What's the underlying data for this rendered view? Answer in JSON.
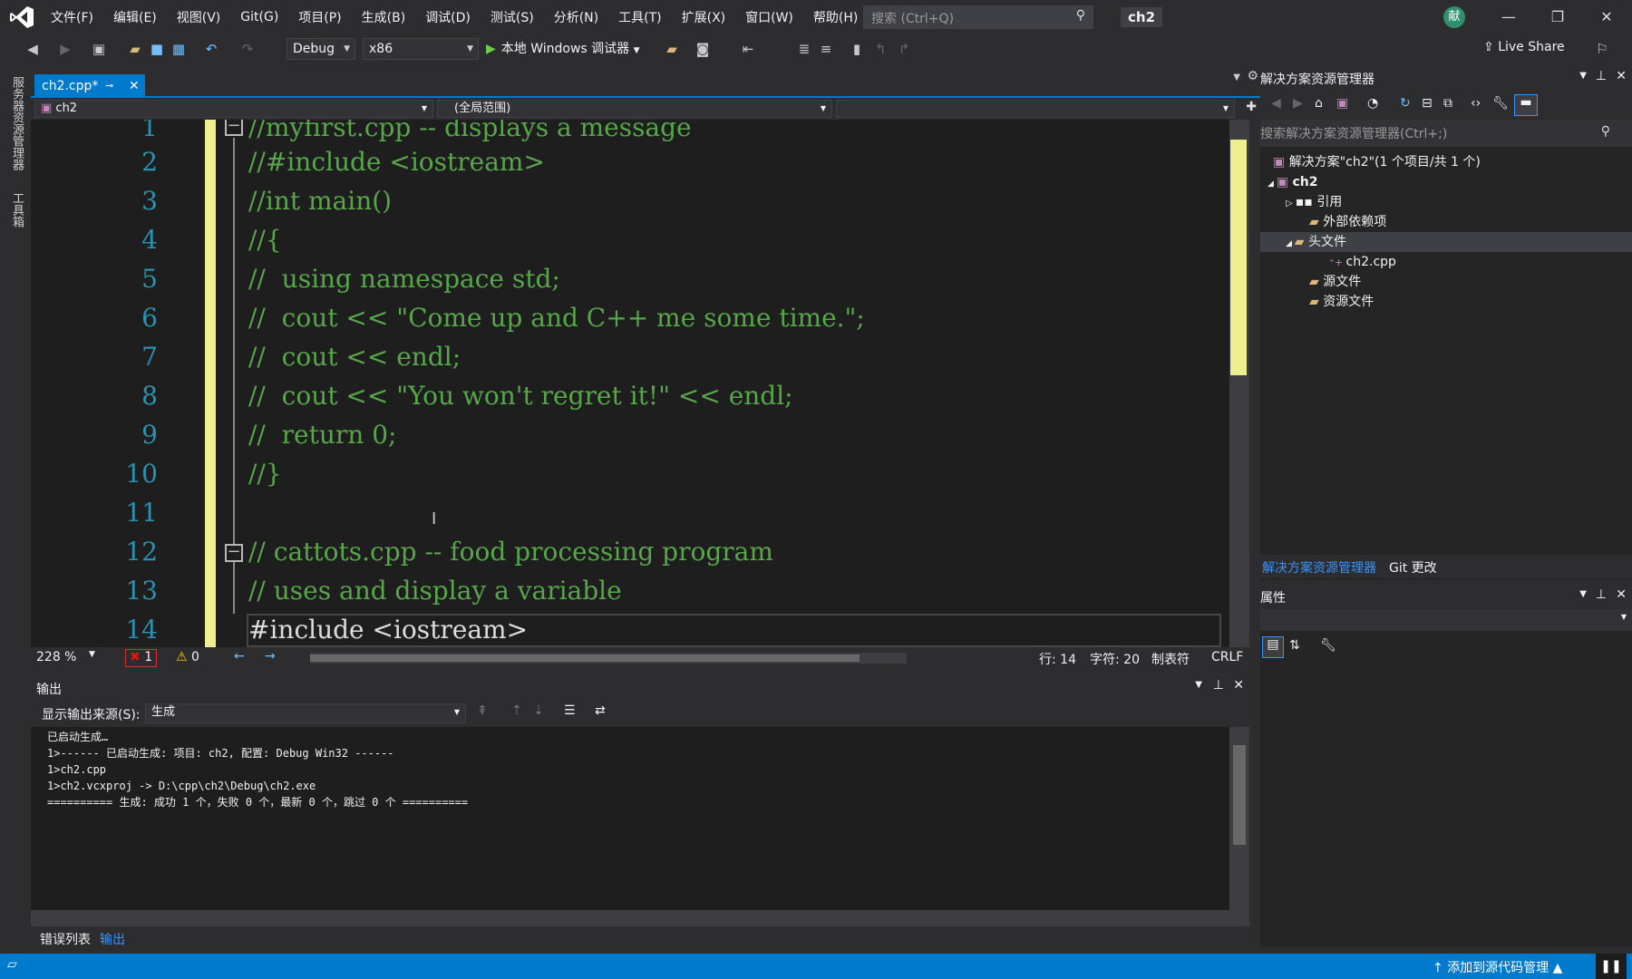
{
  "menubar": {
    "items": [
      "文件(F)",
      "编辑(E)",
      "视图(V)",
      "Git(G)",
      "项目(P)",
      "生成(B)",
      "调试(D)",
      "测试(S)",
      "分析(N)",
      "工具(T)",
      "扩展(X)",
      "窗口(W)",
      "帮助(H)"
    ],
    "search_placeholder": "搜索 (Ctrl+Q)",
    "solution_name": "ch2",
    "avatar_text": "献"
  },
  "toolbar": {
    "config": "Debug",
    "platform": "x86",
    "run_label": "本地 Windows 调试器",
    "live_share": "Live Share"
  },
  "lefttabs": [
    "服务器资源管理器",
    "工具箱"
  ],
  "editor": {
    "tab_label": "ch2.cpp*",
    "nav_project": "ch2",
    "nav_scope": "(全局范围)",
    "lines": [
      {
        "n": "1",
        "text": "//myfirst.cpp -- displays a message"
      },
      {
        "n": "2",
        "text": "//#include <iostream>"
      },
      {
        "n": "3",
        "text": "//int main()"
      },
      {
        "n": "4",
        "text": "//{"
      },
      {
        "n": "5",
        "text": "//  using namespace std;"
      },
      {
        "n": "6",
        "text": "//  cout << \"Come up and C++ me some time.\";"
      },
      {
        "n": "7",
        "text": "//  cout << endl;"
      },
      {
        "n": "8",
        "text": "//  cout << \"You won't regret it!\" << endl;"
      },
      {
        "n": "9",
        "text": "//  return 0;"
      },
      {
        "n": "10",
        "text": "//}"
      },
      {
        "n": "11",
        "text": ""
      },
      {
        "n": "12",
        "text": "// cattots.cpp -- food processing program"
      },
      {
        "n": "13",
        "text": "// uses and display a variable"
      },
      {
        "n": "14",
        "text": "#include <iostream>"
      }
    ]
  },
  "edstatus": {
    "zoom": "228 %",
    "errors": "1",
    "warnings": "0",
    "line": "行: 14",
    "col": "字符: 20",
    "tabs": "制表符",
    "eol": "CRLF"
  },
  "output": {
    "title": "输出",
    "source_label": "显示输出来源(S):",
    "source_value": "生成",
    "lines": [
      "已启动生成…",
      "1>------ 已启动生成: 项目: ch2, 配置: Debug Win32 ------",
      "1>ch2.cpp",
      "1>ch2.vcxproj -> D:\\cpp\\ch2\\Debug\\ch2.exe",
      "========== 生成: 成功 1 个，失败 0 个，最新 0 个，跳过 0 个 =========="
    ]
  },
  "bottomtabs": {
    "errors": "错误列表",
    "output": "输出"
  },
  "solution": {
    "title": "解决方案资源管理器",
    "search_placeholder": "搜索解决方案资源管理器(Ctrl+;)",
    "root": "解决方案\"ch2\"(1 个项目/共 1 个)",
    "project": "ch2",
    "references": "引用",
    "external": "外部依赖项",
    "headers": "头文件",
    "file": "ch2.cpp",
    "sources": "源文件",
    "resources": "资源文件",
    "tab_solution": "解决方案资源管理器",
    "tab_git": "Git 更改"
  },
  "properties": {
    "title": "属性"
  },
  "status": {
    "source_control": "添加到源代码管理"
  }
}
